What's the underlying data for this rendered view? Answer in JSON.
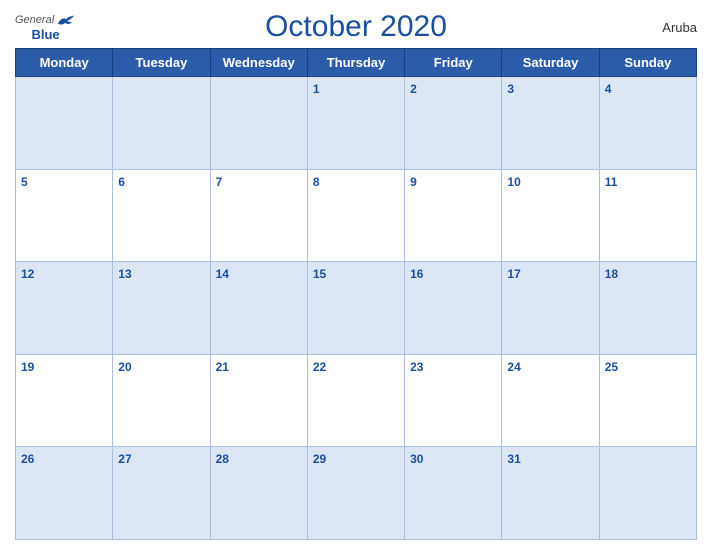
{
  "header": {
    "logo_general": "General",
    "logo_blue": "Blue",
    "title": "October 2020",
    "country": "Aruba"
  },
  "weekdays": [
    "Monday",
    "Tuesday",
    "Wednesday",
    "Thursday",
    "Friday",
    "Saturday",
    "Sunday"
  ],
  "weeks": [
    [
      {
        "day": "",
        "empty": true
      },
      {
        "day": "",
        "empty": true
      },
      {
        "day": "",
        "empty": true
      },
      {
        "day": "1",
        "empty": false
      },
      {
        "day": "2",
        "empty": false
      },
      {
        "day": "3",
        "empty": false
      },
      {
        "day": "4",
        "empty": false
      }
    ],
    [
      {
        "day": "5",
        "empty": false
      },
      {
        "day": "6",
        "empty": false
      },
      {
        "day": "7",
        "empty": false
      },
      {
        "day": "8",
        "empty": false
      },
      {
        "day": "9",
        "empty": false
      },
      {
        "day": "10",
        "empty": false
      },
      {
        "day": "11",
        "empty": false
      }
    ],
    [
      {
        "day": "12",
        "empty": false
      },
      {
        "day": "13",
        "empty": false
      },
      {
        "day": "14",
        "empty": false
      },
      {
        "day": "15",
        "empty": false
      },
      {
        "day": "16",
        "empty": false
      },
      {
        "day": "17",
        "empty": false
      },
      {
        "day": "18",
        "empty": false
      }
    ],
    [
      {
        "day": "19",
        "empty": false
      },
      {
        "day": "20",
        "empty": false
      },
      {
        "day": "21",
        "empty": false
      },
      {
        "day": "22",
        "empty": false
      },
      {
        "day": "23",
        "empty": false
      },
      {
        "day": "24",
        "empty": false
      },
      {
        "day": "25",
        "empty": false
      }
    ],
    [
      {
        "day": "26",
        "empty": false
      },
      {
        "day": "27",
        "empty": false
      },
      {
        "day": "28",
        "empty": false
      },
      {
        "day": "29",
        "empty": false
      },
      {
        "day": "30",
        "empty": false
      },
      {
        "day": "31",
        "empty": false
      },
      {
        "day": "",
        "empty": true
      }
    ]
  ]
}
